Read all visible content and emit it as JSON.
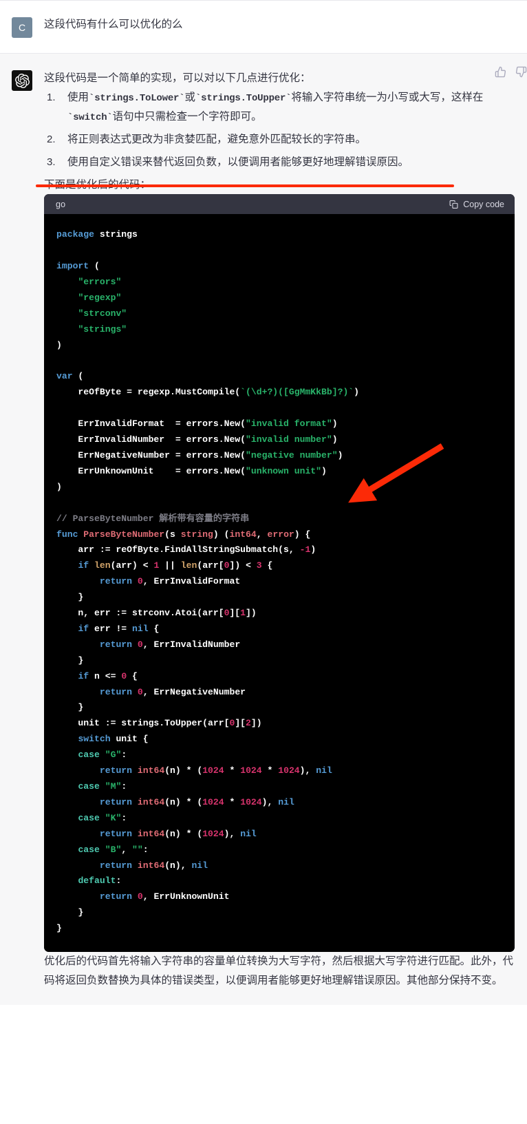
{
  "user": {
    "avatar_initial": "C",
    "avatar_color": "#72889b",
    "message": "这段代码有什么可以优化的么"
  },
  "assistant": {
    "avatar_icon": "openai-logo-icon",
    "avatar_color": "#10100f",
    "intro": "这段代码是一个简单的实现，可以对以下几点进行优化：",
    "optimizations": [
      "使用`strings.ToLower`或`strings.ToUpper`将输入字符串统一为小写或大写，这样在`switch`语句中只需检查一个字符即可。",
      "将正则表达式更改为非贪婪匹配，避免意外匹配较长的字符串。",
      "使用自定义错误来替代返回负数，以便调用者能够更好地理解错误原因。"
    ],
    "lead_in": "下面是优化后的代码：",
    "outro": "优化后的代码首先将输入字符串的容量单位转换为大写字符，然后根据大写字符进行匹配。此外，代码将返回负数替换为具体的错误类型，以便调用者能够更好地理解错误原因。其他部分保持不变。",
    "feedback": {
      "thumbs_up_icon": "thumbs-up-icon",
      "thumbs_down_icon": "thumbs-down-icon"
    }
  },
  "codeblock": {
    "language": "go",
    "copy_label": "Copy code",
    "copy_icon": "clipboard-icon",
    "background": "#000000",
    "header_background": "#343541",
    "code_lines": [
      "package strings",
      "",
      "import (",
      "    \"errors\"",
      "    \"regexp\"",
      "    \"strconv\"",
      "    \"strings\"",
      ")",
      "",
      "var (",
      "    reOfByte = regexp.MustCompile(`(\\d+?)([GgMmKkBb]?)`)",
      "",
      "    ErrInvalidFormat  = errors.New(\"invalid format\")",
      "    ErrInvalidNumber  = errors.New(\"invalid number\")",
      "    ErrNegativeNumber = errors.New(\"negative number\")",
      "    ErrUnknownUnit    = errors.New(\"unknown unit\")",
      ")",
      "",
      "// ParseByteNumber 解析带有容量的字符串",
      "func ParseByteNumber(s string) (int64, error) {",
      "    arr := reOfByte.FindAllStringSubmatch(s, -1)",
      "    if len(arr) < 1 || len(arr[0]) < 3 {",
      "        return 0, ErrInvalidFormat",
      "    }",
      "    n, err := strconv.Atoi(arr[0][1])",
      "    if err != nil {",
      "        return 0, ErrInvalidNumber",
      "    }",
      "    if n <= 0 {",
      "        return 0, ErrNegativeNumber",
      "    }",
      "    unit := strings.ToUpper(arr[0][2])",
      "    switch unit {",
      "    case \"G\":",
      "        return int64(n) * (1024 * 1024 * 1024), nil",
      "    case \"M\":",
      "        return int64(n) * (1024 * 1024), nil",
      "    case \"K\":",
      "        return int64(n) * (1024), nil",
      "    case \"B\", \"\":",
      "        return int64(n), nil",
      "    default:",
      "        return 0, ErrUnknownUnit",
      "    }",
      "}"
    ]
  },
  "annotations": {
    "underline_color": "#fc2a07",
    "arrow_color": "#fc2a07",
    "underline_target": "使用自定义错误来替代返回负数，以便调用者能够更好地理解错误原因。",
    "arrow_target": "ErrInvalidNumber  = errors.New(\"invalid number\")"
  }
}
